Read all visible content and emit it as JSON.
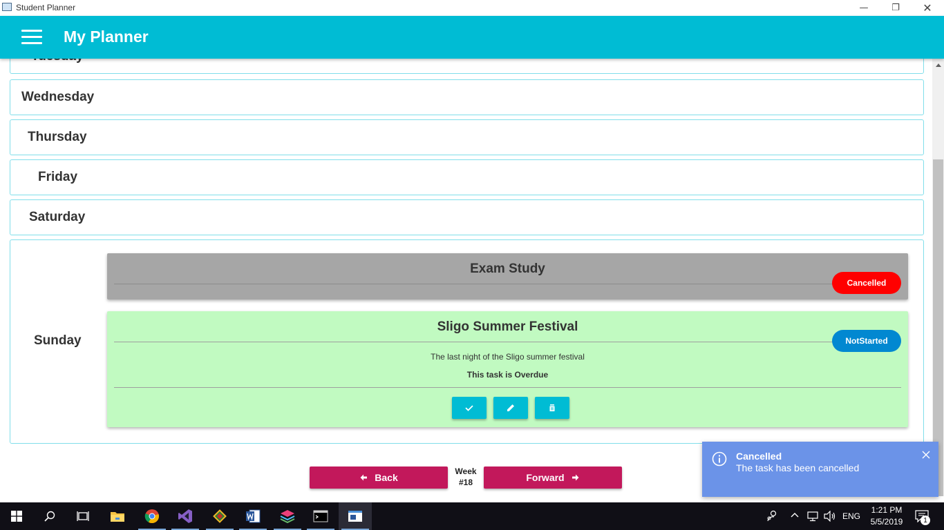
{
  "window": {
    "title": "Student Planner"
  },
  "appbar": {
    "title": "My Planner"
  },
  "days": {
    "tuesday": "Tuesday",
    "wednesday": "Wednesday",
    "thursday": "Thursday",
    "friday": "Friday",
    "saturday": "Saturday",
    "sunday": "Sunday"
  },
  "tasks": [
    {
      "title": "Exam Study",
      "status": "Cancelled"
    },
    {
      "title": "Sligo Summer Festival",
      "status": "NotStarted",
      "description": "The last night of the Sligo summer festival",
      "note": "This task is Overdue"
    }
  ],
  "navigation": {
    "back_label": "Back",
    "week_label": "Week",
    "week_number": "#18",
    "forward_label": "Forward"
  },
  "toast": {
    "title": "Cancelled",
    "message": "The task has been cancelled"
  },
  "taskbar": {
    "language": "ENG",
    "time": "1:21 PM",
    "date": "5/5/2019",
    "notification_count": "1"
  },
  "colors": {
    "appbar": "#00bcd4",
    "accent_button": "#c2185b",
    "cancelled_card": "#a6a6a6",
    "notstarted_card": "#c1fac1",
    "cancelled_pill": "#ff0000",
    "notstarted_pill": "#0288d1",
    "toast": "#6b93e8"
  }
}
